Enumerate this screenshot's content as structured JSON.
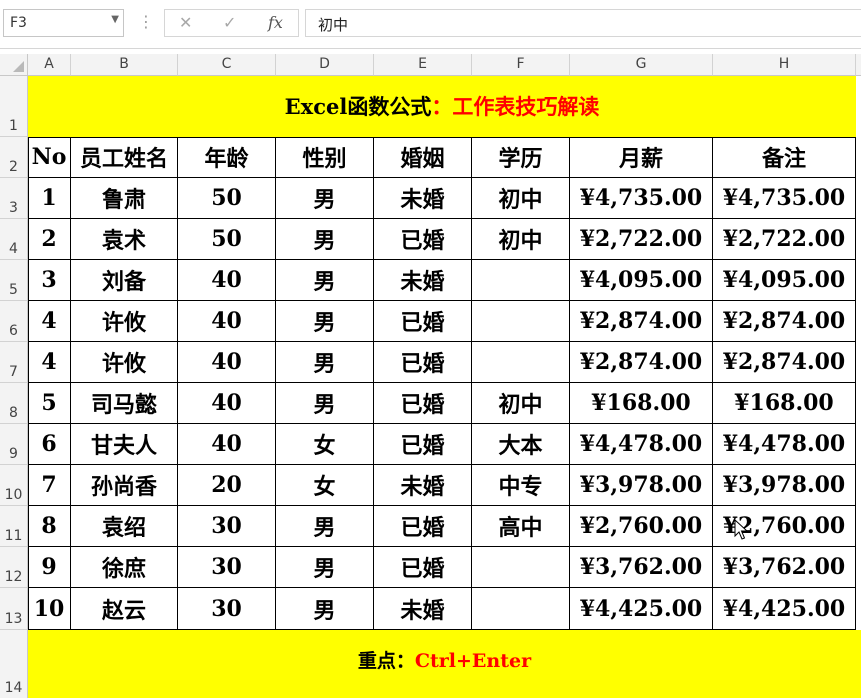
{
  "formula_bar": {
    "name_box": "F3",
    "cancel_icon": "✕",
    "enter_icon": "✓",
    "fx_label": "fx",
    "formula": "初中"
  },
  "columns": [
    "A",
    "B",
    "C",
    "D",
    "E",
    "F",
    "G",
    "H"
  ],
  "row_numbers": [
    "1",
    "2",
    "3",
    "4",
    "5",
    "6",
    "7",
    "8",
    "9",
    "10",
    "11",
    "12",
    "13",
    "14"
  ],
  "title": {
    "black": "Excel函数公式",
    "red": "：工作表技巧解读"
  },
  "headers": [
    "No",
    "员工姓名",
    "年龄",
    "性别",
    "婚姻",
    "学历",
    "月薪",
    "备注"
  ],
  "rows": [
    [
      "1",
      "鲁肃",
      "50",
      "男",
      "未婚",
      "初中",
      "¥4,735.00",
      "¥4,735.00"
    ],
    [
      "2",
      "袁术",
      "50",
      "男",
      "已婚",
      "初中",
      "¥2,722.00",
      "¥2,722.00"
    ],
    [
      "3",
      "刘备",
      "40",
      "男",
      "未婚",
      "",
      "¥4,095.00",
      "¥4,095.00"
    ],
    [
      "4",
      "许攸",
      "40",
      "男",
      "已婚",
      "",
      "¥2,874.00",
      "¥2,874.00"
    ],
    [
      "4",
      "许攸",
      "40",
      "男",
      "已婚",
      "",
      "¥2,874.00",
      "¥2,874.00"
    ],
    [
      "5",
      "司马懿",
      "40",
      "男",
      "已婚",
      "初中",
      "¥168.00",
      "¥168.00"
    ],
    [
      "6",
      "甘夫人",
      "40",
      "女",
      "已婚",
      "大本",
      "¥4,478.00",
      "¥4,478.00"
    ],
    [
      "7",
      "孙尚香",
      "20",
      "女",
      "未婚",
      "中专",
      "¥3,978.00",
      "¥3,978.00"
    ],
    [
      "8",
      "袁绍",
      "30",
      "男",
      "已婚",
      "高中",
      "¥2,760.00",
      "¥2,760.00"
    ],
    [
      "9",
      "徐庶",
      "30",
      "男",
      "已婚",
      "",
      "¥3,762.00",
      "¥3,762.00"
    ],
    [
      "10",
      "赵云",
      "30",
      "男",
      "未婚",
      "",
      "¥4,425.00",
      "¥4,425.00"
    ]
  ],
  "footer": {
    "black": "重点：",
    "red": "Ctrl+Enter"
  },
  "colors": {
    "banner": "#ffff00",
    "accent_red": "#ff0000",
    "header_bg": "#f3f3f3"
  },
  "icons": {
    "cursor": "mouse-pointer-icon"
  }
}
